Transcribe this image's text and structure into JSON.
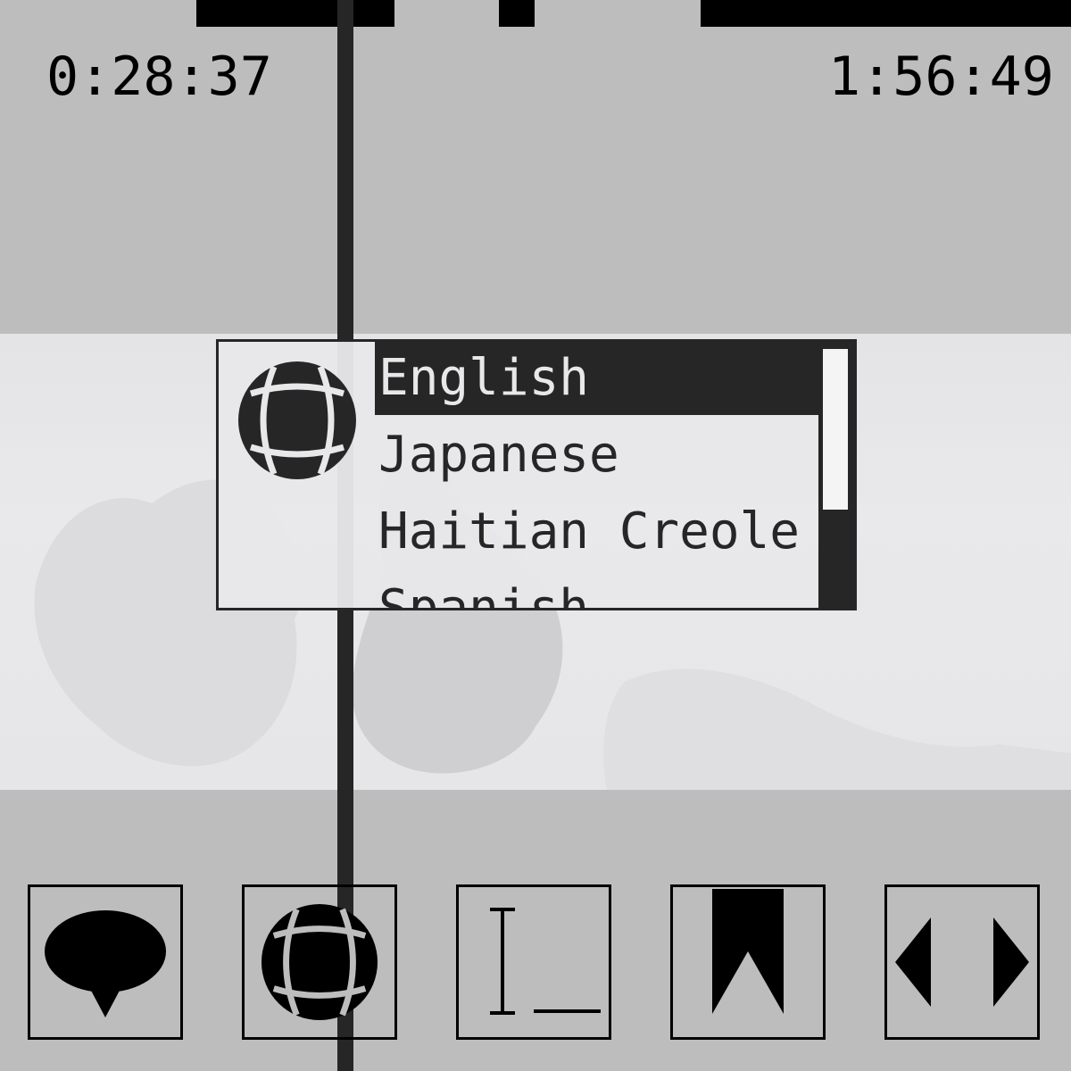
{
  "player": {
    "elapsed_time": "0:28:37",
    "total_time": "1:56:49"
  },
  "language_menu": {
    "languages": [
      "English",
      "Japanese",
      "Haitian Creole",
      "Spanish"
    ],
    "selected": "English"
  },
  "controls": {
    "buttons": [
      {
        "icon": "speech-bubble-icon"
      },
      {
        "icon": "globe-icon"
      },
      {
        "icon": "text-cursor-icon"
      },
      {
        "icon": "bookmark-icon"
      },
      {
        "icon": "left-right-arrows-icon"
      }
    ]
  },
  "colors": {
    "background": "#bdbdbd",
    "dark": "#262626",
    "black": "#000000"
  }
}
